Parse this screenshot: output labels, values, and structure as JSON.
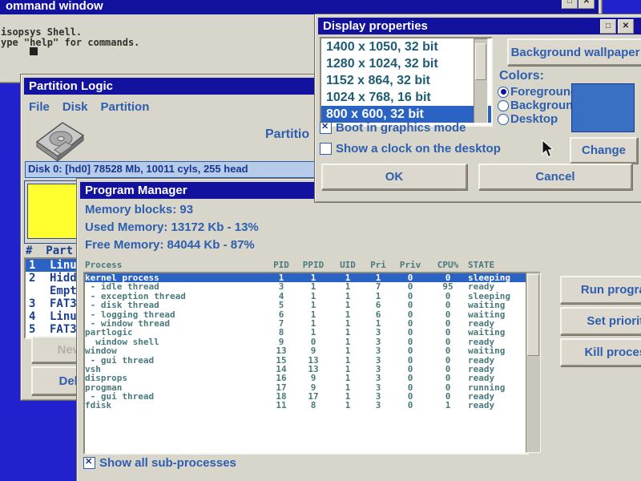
{
  "icons": {
    "minimize": "□",
    "close": "✕"
  },
  "colors": {
    "desktop": "#2121ce",
    "titlebar": "#12129e",
    "selection": "#2a63c4",
    "accent_text": "#2e5fae"
  },
  "command_window": {
    "title": "ommand window",
    "line1": "isopsys Shell.",
    "line2": "ype \"help\" for commands."
  },
  "display_properties": {
    "title": "Display properties",
    "resolutions": [
      "1400 x 1050, 32 bit",
      "1280 x 1024, 32 bit",
      "1152 x 864, 32 bit",
      "1024 x 768, 16 bit",
      "800 x 600, 32 bit"
    ],
    "selected_index": 4,
    "wallpaper_button": "Background wallpaper",
    "colors_label": "Colors:",
    "radios": [
      {
        "label": "Foreground",
        "selected": true
      },
      {
        "label": "Background",
        "selected": false
      },
      {
        "label": "Desktop",
        "selected": false
      }
    ],
    "swatch_color": "#3a70c4",
    "change_button": "Change",
    "checkboxes": [
      {
        "label": "Boot in graphics mode",
        "checked": true
      },
      {
        "label": "Show a clock on the desktop",
        "checked": false
      }
    ],
    "ok_button": "OK",
    "cancel_button": "Cancel"
  },
  "partition_logic": {
    "title": "Partition Logic",
    "menu": [
      "File",
      "Disk",
      "Partition"
    ],
    "partition_label": "Partitio",
    "disk_line": "Disk 0: [hd0] 78528 Mb, 10011 cyls, 255 head",
    "list_header": "#  Part",
    "partitions": [
      {
        "num": "1",
        "name": "Linu"
      },
      {
        "num": "2",
        "name": "Hidd"
      },
      {
        "num": "",
        "name": "Empt"
      },
      {
        "num": "3",
        "name": "FAT3"
      },
      {
        "num": "4",
        "name": "Linu"
      },
      {
        "num": "5",
        "name": "FAT3"
      }
    ],
    "selected_index": 0,
    "new_button": "New",
    "delete_button": "Delete"
  },
  "program_manager": {
    "title": "Program Manager",
    "memory_blocks": "Memory blocks: 93",
    "used_memory": "Used Memory: 13172 Kb - 13%",
    "free_memory": "Free Memory: 84044 Kb - 87%",
    "table": {
      "columns": [
        "Process",
        "PID",
        "PPID",
        "UID",
        "Pri",
        "Priv",
        "CPU%",
        "STATE"
      ],
      "selected_index": 0,
      "rows": [
        [
          "kernel process",
          "1",
          "1",
          "1",
          "1",
          "0",
          "0",
          "sleeping"
        ],
        [
          " - idle thread",
          "3",
          "1",
          "1",
          "7",
          "0",
          "95",
          "ready"
        ],
        [
          " - exception thread",
          "4",
          "1",
          "1",
          "1",
          "0",
          "0",
          "sleeping"
        ],
        [
          " - disk thread",
          "5",
          "1",
          "1",
          "6",
          "0",
          "0",
          "waiting"
        ],
        [
          " - logging thread",
          "6",
          "1",
          "1",
          "6",
          "0",
          "0",
          "waiting"
        ],
        [
          " - window thread",
          "7",
          "1",
          "1",
          "1",
          "0",
          "0",
          "ready"
        ],
        [
          "partlogic",
          "8",
          "1",
          "1",
          "3",
          "0",
          "0",
          "waiting"
        ],
        [
          "  window shell",
          "9",
          "0",
          "1",
          "3",
          "0",
          "0",
          "ready"
        ],
        [
          "window",
          "13",
          "9",
          "1",
          "3",
          "0",
          "0",
          "waiting"
        ],
        [
          " - gui thread",
          "15",
          "13",
          "1",
          "3",
          "0",
          "0",
          "ready"
        ],
        [
          "vsh",
          "14",
          "13",
          "1",
          "3",
          "0",
          "0",
          "ready"
        ],
        [
          "disprops",
          "16",
          "9",
          "1",
          "3",
          "0",
          "0",
          "ready"
        ],
        [
          "progman",
          "17",
          "9",
          "1",
          "3",
          "0",
          "0",
          "running"
        ],
        [
          " - gui thread",
          "18",
          "17",
          "1",
          "3",
          "0",
          "0",
          "ready"
        ],
        [
          "fdisk",
          "11",
          "8",
          "1",
          "3",
          "0",
          "1",
          "ready"
        ]
      ]
    },
    "buttons": [
      "Run program",
      "Set priority",
      "Kill process"
    ],
    "show_all": {
      "label": "Show all sub-processes",
      "checked": true
    }
  }
}
